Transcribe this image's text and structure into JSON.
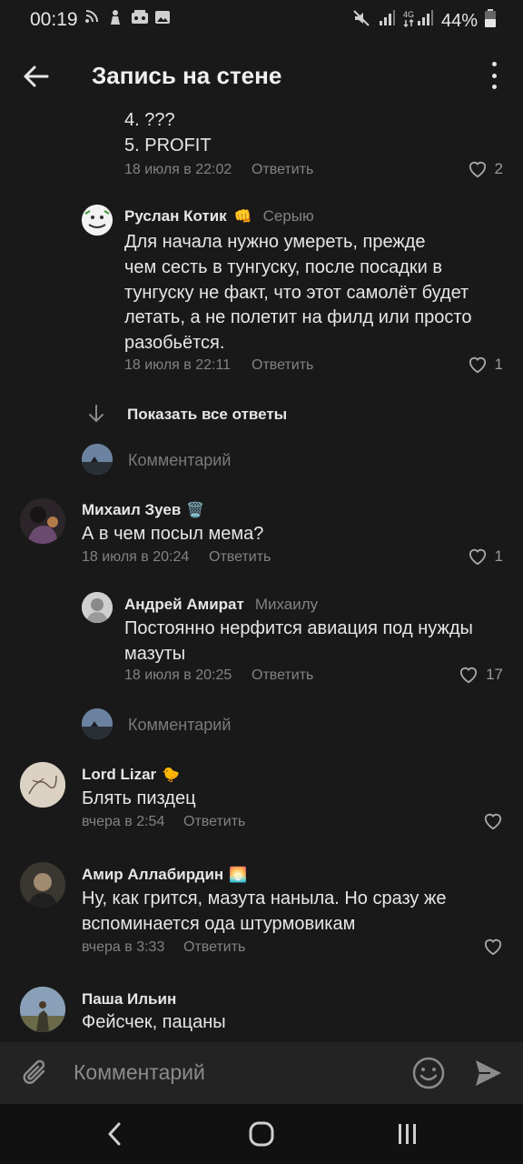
{
  "status_bar": {
    "time": "00:19",
    "battery": "44%"
  },
  "header": {
    "title": "Запись на стене"
  },
  "top_comment_tail": {
    "lines": [
      "4. ???",
      "5. PROFIT"
    ],
    "date": "18 июля в 22:02",
    "reply": "Ответить",
    "likes": "2"
  },
  "reply_ruslan": {
    "name": "Руслан Котик",
    "emoji": "👊",
    "to": "Серыю",
    "lines": [
      "Для начала нужно умереть, прежде",
      "чем сесть в тунгуску, после посадки в",
      "тунгуску не факт, что этот самолёт будет",
      "летать, а не полетит на филд или просто",
      "разобьётся."
    ],
    "date": "18 июля в 22:11",
    "reply": "Ответить",
    "likes": "1"
  },
  "show_all": "Показать все ответы",
  "comment_placeholder": "Комментарий",
  "comment_mikhail": {
    "name": "Михаил Зуев",
    "emoji": "🗑️",
    "text": "А в чем посыл мема?",
    "date": "18 июля в 20:24",
    "reply": "Ответить",
    "likes": "1"
  },
  "reply_andrey": {
    "name": "Андрей Амират",
    "to": "Михаилу",
    "lines": [
      "Постоянно нерфится авиация под нужды",
      "мазуты"
    ],
    "date": "18 июля в 20:25",
    "reply": "Ответить",
    "likes": "17"
  },
  "comment_lord": {
    "name": "Lord Lizar",
    "emoji": "🐤",
    "text": "Блять пиздец",
    "date": "вчера в 2:54",
    "reply": "Ответить"
  },
  "comment_amir": {
    "name": "Амир Аллабирдин",
    "emoji": "🌅",
    "lines": [
      "Ну, как грится, мазута нанылa. Но сразу же",
      "вспоминается ода штурмовикам"
    ],
    "date": "вчера в 3:33",
    "reply": "Ответить"
  },
  "comment_pasha": {
    "name": "Паша Ильин",
    "text": "Фейсчек, пацаны"
  },
  "input": {
    "placeholder": "Комментарий"
  },
  "colors": {
    "background": "#191919",
    "input_bar": "#232323",
    "nav_bar": "#111111",
    "meta_text": "#828282"
  }
}
